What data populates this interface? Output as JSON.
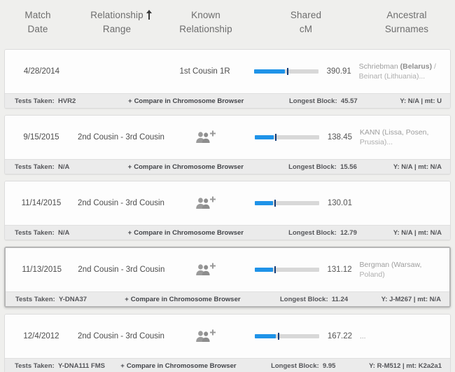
{
  "header": {
    "columns": [
      {
        "line1": "Match",
        "line2": "Date",
        "sort": null
      },
      {
        "line1": "Relationship",
        "line2": "Range",
        "sort": "ascending-sort-arrow"
      },
      {
        "line1": "Known",
        "line2": "Relationship",
        "sort": null
      },
      {
        "line1": "Shared",
        "line2": "cM",
        "sort": null
      },
      {
        "line1": "Ancestral",
        "line2": "Surnames",
        "sort": null
      }
    ]
  },
  "labels": {
    "tests_taken": "Tests Taken:",
    "compare": "Compare in Chromosome Browser",
    "compare_plus": "+",
    "longest_block": "Longest Block:",
    "ellipsis": "..."
  },
  "colors": {
    "bar_fill": "#1f93e8",
    "bar_track": "#d8d8d8",
    "bar_tick": "#123c78",
    "page_bg": "#efefed",
    "card_bg": "#fdfdfd",
    "footer_bg": "#ebebeb"
  },
  "rows": [
    {
      "match_date": "4/28/2014",
      "relationship_range": "",
      "known_relationship": "1st Cousin 1R",
      "has_add_relationship_icon": false,
      "shared_cm": "390.91",
      "bar_fill_pct": 48,
      "bar_tick_pct": 51,
      "surnames_prefix": "Schriebman",
      "surnames_bold": "(Belarus)",
      "surnames_sep": " / ",
      "surnames_rest": "Beinart",
      "surnames_tail": "(Lithuania)...",
      "tests_taken": "HVR2",
      "longest_block": "45.57",
      "haplogroups": "Y: N/A  |  mt: U",
      "selected": false
    },
    {
      "match_date": "9/15/2015",
      "relationship_range": "2nd Cousin - 3rd Cousin",
      "known_relationship": "",
      "has_add_relationship_icon": true,
      "shared_cm": "138.45",
      "bar_fill_pct": 30,
      "bar_tick_pct": 32,
      "surnames_prefix": "KANN (Lissa, Posen,",
      "surnames_bold": "",
      "surnames_sep": "",
      "surnames_rest": "",
      "surnames_tail": "Prussia)...",
      "tests_taken": "N/A",
      "longest_block": "15.56",
      "haplogroups": "Y: N/A  |  mt: N/A",
      "selected": false
    },
    {
      "match_date": "11/14/2015",
      "relationship_range": "2nd Cousin - 3rd Cousin",
      "known_relationship": "",
      "has_add_relationship_icon": true,
      "shared_cm": "130.01",
      "bar_fill_pct": 29,
      "bar_tick_pct": 31,
      "surnames_prefix": "",
      "surnames_bold": "",
      "surnames_sep": "",
      "surnames_rest": "",
      "surnames_tail": "",
      "tests_taken": "N/A",
      "longest_block": "12.79",
      "haplogroups": "Y: N/A  |  mt: N/A",
      "selected": false
    },
    {
      "match_date": "11/13/2015",
      "relationship_range": "2nd Cousin - 3rd Cousin",
      "known_relationship": "",
      "has_add_relationship_icon": true,
      "shared_cm": "131.12",
      "bar_fill_pct": 29,
      "bar_tick_pct": 31,
      "surnames_prefix": "Bergman (Warsaw,",
      "surnames_bold": "",
      "surnames_sep": "",
      "surnames_rest": "",
      "surnames_tail": "Poland)",
      "tests_taken": "Y-DNA37",
      "longest_block": "11.24",
      "haplogroups": "Y: J-M267  |  mt: N/A",
      "selected": true
    },
    {
      "match_date": "12/4/2012",
      "relationship_range": "2nd Cousin - 3rd Cousin",
      "known_relationship": "",
      "has_add_relationship_icon": true,
      "shared_cm": "167.22",
      "bar_fill_pct": 33,
      "bar_tick_pct": 36,
      "surnames_prefix": "...",
      "surnames_bold": "",
      "surnames_sep": "",
      "surnames_rest": "",
      "surnames_tail": "",
      "tests_taken": "Y-DNA111  FMS",
      "longest_block": "9.95",
      "haplogroups": "Y: R-M512  |  mt: K2a2a1",
      "selected": false
    }
  ]
}
